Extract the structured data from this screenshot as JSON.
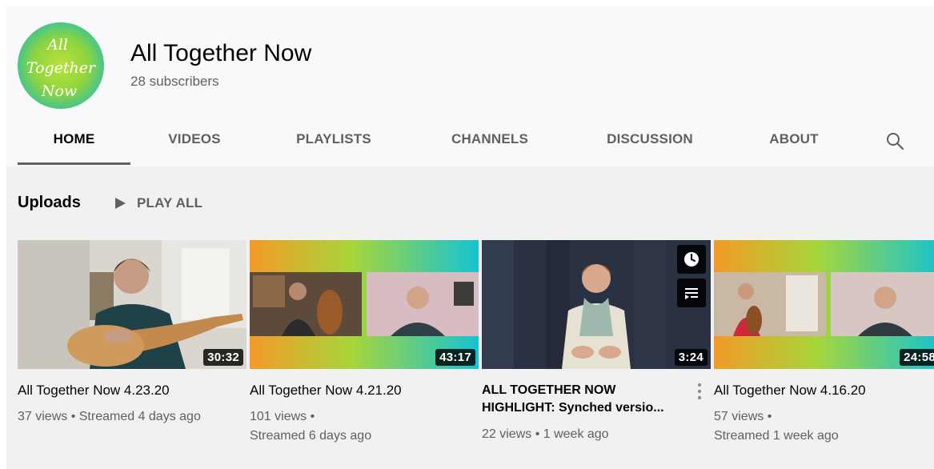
{
  "channel": {
    "logo_text": [
      "All",
      "Together",
      "Now"
    ],
    "name": "All Together Now",
    "subscribers": "28 subscribers"
  },
  "tabs": [
    {
      "label": "HOME",
      "active": true
    },
    {
      "label": "VIDEOS"
    },
    {
      "label": "PLAYLISTS"
    },
    {
      "label": "CHANNELS"
    },
    {
      "label": "DISCUSSION"
    },
    {
      "label": "ABOUT"
    }
  ],
  "search_icon": "search-icon",
  "uploads": {
    "label": "Uploads",
    "play_all": "PLAY ALL"
  },
  "videos": [
    {
      "title": "All Together Now 4.23.20",
      "duration": "30:32",
      "meta_line1": "37 views • Streamed 4 days ago",
      "meta_line2": ""
    },
    {
      "title": "All Together Now 4.21.20",
      "duration": "43:17",
      "meta_line1": "101 views •",
      "meta_line2": "Streamed 6 days ago"
    },
    {
      "title_line1": "ALL TOGETHER NOW",
      "title_line2": "HIGHLIGHT: Synched versio...",
      "duration": "3:24",
      "meta_line1": "22 views • 1 week ago",
      "meta_line2": ""
    },
    {
      "title": "All Together Now 4.16.20",
      "duration": "24:58",
      "meta_line1": "57 views •",
      "meta_line2": "Streamed 1 week ago"
    }
  ],
  "colors": {
    "background": "#f1f1f1",
    "header": "#f9f9f9",
    "text_primary": "#030303",
    "text_secondary": "#606060"
  }
}
